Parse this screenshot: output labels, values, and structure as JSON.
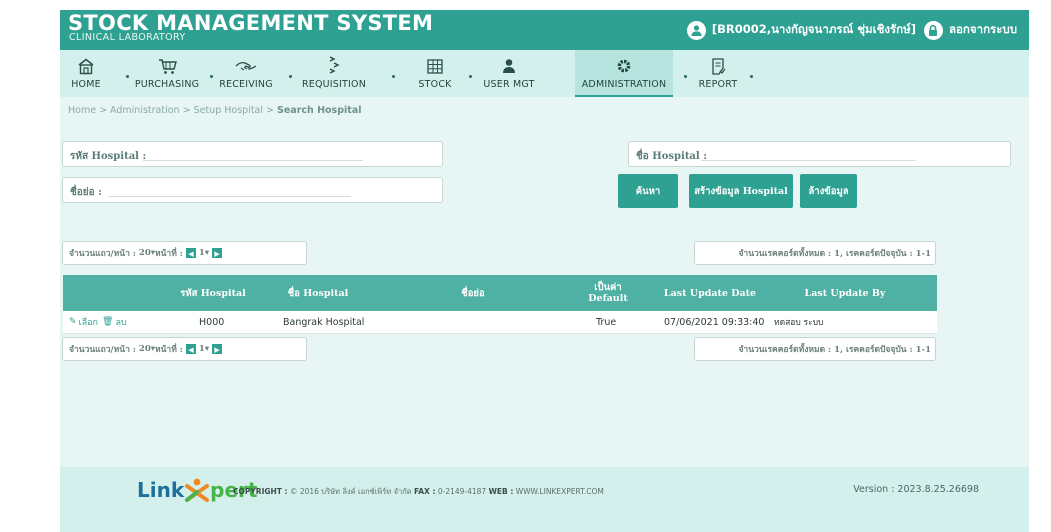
{
  "header": {
    "title": "STOCK MANAGEMENT SYSTEM",
    "subtitle": "CLINICAL LABORATORY",
    "user": "[BR0002,นางกัญจนาภรณ์ ชุ่มเชิงรักษ์]",
    "logout_label": "ลอกจากระบบ"
  },
  "menu": {
    "items": [
      {
        "label": "HOME",
        "icon": "home-icon"
      },
      {
        "label": "PURCHASING",
        "icon": "cart-icon"
      },
      {
        "label": "RECEIVING",
        "icon": "handshake-icon"
      },
      {
        "label": "REQUISITION",
        "icon": "flow-icon"
      },
      {
        "label": "STOCK",
        "icon": "grid-icon"
      },
      {
        "label": "USER MGT",
        "icon": "user-icon"
      },
      {
        "label": "ADMINISTRATION",
        "icon": "gear-icon"
      },
      {
        "label": "REPORT",
        "icon": "report-icon"
      }
    ],
    "active": "ADMINISTRATION"
  },
  "breadcrumb": {
    "path": "Home > Administration > Setup Hospital > ",
    "current": "Search Hospital"
  },
  "form": {
    "hospital_code_label": "รหัส Hospital :",
    "hospital_name_label": "ชื่อ Hospital :",
    "short_name_label": "ชื่อย่อ :"
  },
  "buttons": {
    "search": "ค้นหา",
    "create": "สร้างข้อมูล Hospital",
    "clear": "ล้างข้อมูล"
  },
  "pager": {
    "rows_per_page_label": "จำนวนแถว/หน้า :",
    "rows_per_page_value": "20▾",
    "page_label": "หน้าที่ :",
    "page_value": "1▾",
    "record_info": "จำนวนเรคคอร์ดทั้งหมด : 1, เรคคอร์ดปัจจุบัน : 1-1"
  },
  "table": {
    "headers": [
      "",
      "รหัส Hospital",
      "ชื่อ Hospital",
      "ชื่อย่อ",
      "เป็นค่า Default",
      "Last Update Date",
      "Last Update By"
    ],
    "rows": [
      {
        "edit": "เลือก",
        "delete": "ลบ",
        "code": "H000",
        "name": "Bangrak Hospital",
        "short": "",
        "default": "True",
        "date": "07/06/2021 09:33:40",
        "by": "ทดสอบ ระบบ"
      }
    ]
  },
  "footer": {
    "logo_left": "Link",
    "logo_right": "pert",
    "copyright_prefix": "COPYRIGHT :",
    "copyright_text": "© 2016 บริษัท ลิงค์ เอกซ์เพิร์ท จำกัด",
    "fax_label": "FAX :",
    "fax_value": "0-2149-4187",
    "web_label": "WEB :",
    "web_value": "WWW.LINKEXPERT.COM",
    "version": "Version : 2023.8.25.26698"
  },
  "colors": {
    "brand": "#2fa192",
    "menu_bg": "#d4f0ec",
    "content_bg": "#e7f6f4",
    "table_header": "#4fb1a3"
  }
}
